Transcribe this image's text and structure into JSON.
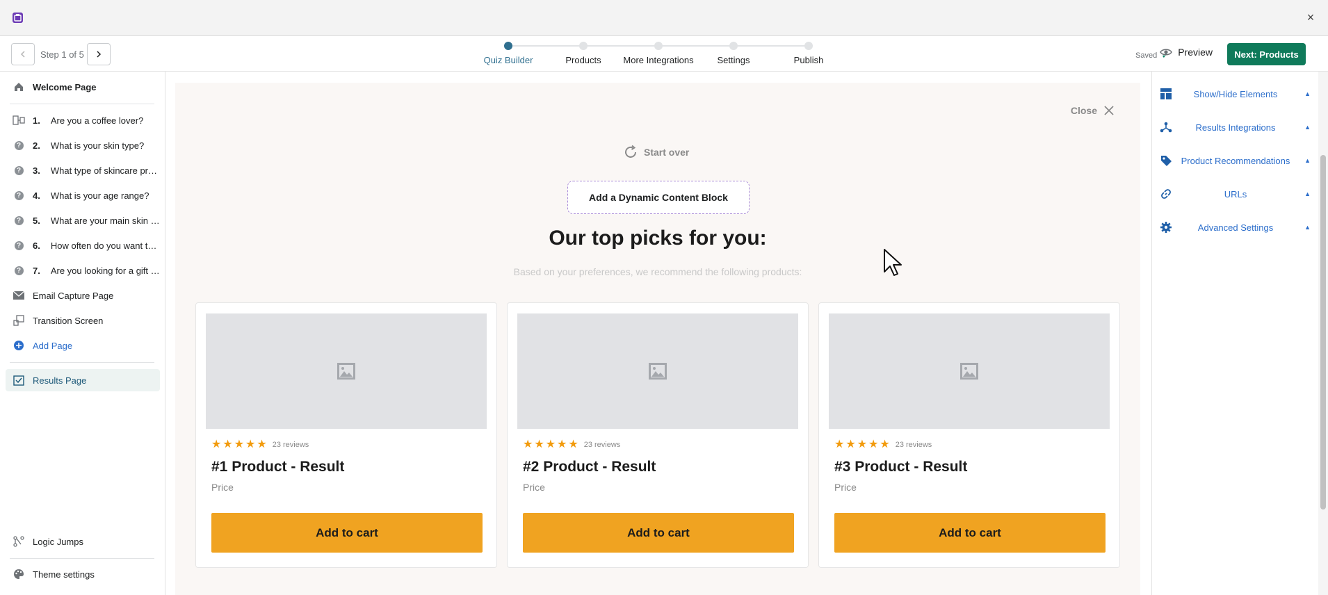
{
  "window": {
    "close_glyph": "×"
  },
  "topbar": {
    "step_text": "Step 1 of 5",
    "steps": [
      {
        "label": "Quiz Builder",
        "active": true
      },
      {
        "label": "Products",
        "active": false
      },
      {
        "label": "More Integrations",
        "active": false
      },
      {
        "label": "Settings",
        "active": false
      },
      {
        "label": "Publish",
        "active": false
      }
    ],
    "saved_label": "Saved",
    "preview_label": "Preview",
    "next_label": "Next: Products"
  },
  "sidebar": {
    "welcome": "Welcome Page",
    "questions": [
      {
        "num": "1.",
        "label": "Are you a coffee lover?",
        "icon": "split-icon"
      },
      {
        "num": "2.",
        "label": "What is your skin type?",
        "icon": "question-icon"
      },
      {
        "num": "3.",
        "label": "What type of skincare prod...",
        "icon": "question-icon"
      },
      {
        "num": "4.",
        "label": "What is your age range?",
        "icon": "question-icon"
      },
      {
        "num": "5.",
        "label": "What are your main skin co...",
        "icon": "question-icon"
      },
      {
        "num": "6.",
        "label": "How often do you want to ...",
        "icon": "question-icon"
      },
      {
        "num": "7.",
        "label": "Are you looking for a gift o...",
        "icon": "question-icon"
      }
    ],
    "email_capture": "Email Capture Page",
    "transition": "Transition Screen",
    "add_page": "Add Page",
    "results": "Results Page",
    "logic_jumps": "Logic Jumps",
    "theme_settings": "Theme settings"
  },
  "canvas": {
    "close_label": "Close",
    "start_over": "Start over",
    "dynamic_block": "Add a Dynamic Content Block",
    "heading": "Our top picks for you:",
    "subheading": "Based on your preferences, we recommend the following products:",
    "products": [
      {
        "reviews": "23 reviews",
        "title": "#1 Product - Result",
        "price": "Price",
        "cta": "Add to cart",
        "rating": 5
      },
      {
        "reviews": "23 reviews",
        "title": "#2 Product - Result",
        "price": "Price",
        "cta": "Add to cart",
        "rating": 5
      },
      {
        "reviews": "23 reviews",
        "title": "#3 Product - Result",
        "price": "Price",
        "cta": "Add to cart",
        "rating": 5
      }
    ]
  },
  "right_panel": {
    "items": [
      {
        "label": "Show/Hide Elements",
        "icon": "layout-icon"
      },
      {
        "label": "Results Integrations",
        "icon": "integrations-icon"
      },
      {
        "label": "Product Recommendations",
        "icon": "tag-icon"
      },
      {
        "label": "URLs",
        "icon": "link-icon"
      },
      {
        "label": "Advanced Settings",
        "icon": "gear-icon"
      }
    ]
  },
  "colors": {
    "accent": "#2f6f8f",
    "primary_button": "#0f7a5a",
    "cart_button": "#f0a321",
    "link_blue": "#2c6ecb",
    "star": "#f29b0d"
  }
}
